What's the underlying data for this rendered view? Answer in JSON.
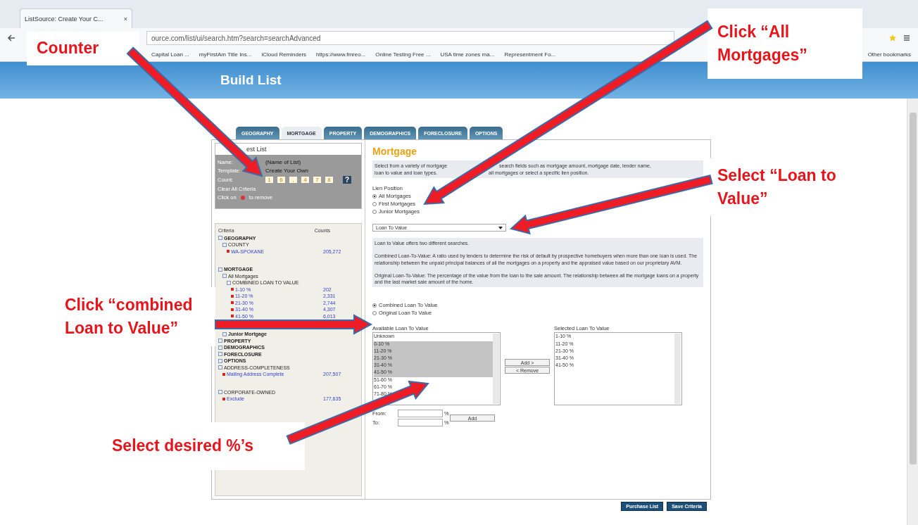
{
  "browser": {
    "tab_title": "ListSource: Create Your C...",
    "tab_close": "×",
    "address": "ource.com/list/ui/search.htm?search=searchAdvanced",
    "bookmarks": [
      "Capital Loan ...",
      "myFirstAm Title Ins...",
      "iCloud Reminders",
      "https://www.fmreo...",
      "Online Testing Free ...",
      "USA time zones ma...",
      "Representment Fo..."
    ],
    "other_bookmarks": "Other bookmarks"
  },
  "header": {
    "title": "Build List"
  },
  "tabs": [
    {
      "label": "GEOGRAPHY",
      "selected": false
    },
    {
      "label": "MORTGAGE",
      "selected": true
    },
    {
      "label": "PROPERTY",
      "selected": false
    },
    {
      "label": "DEMOGRAPHICS",
      "selected": false
    },
    {
      "label": "FORECLOSURE",
      "selected": false
    },
    {
      "label": "OPTIONS",
      "selected": false
    }
  ],
  "request": {
    "title": "est List",
    "name_label": "Name:",
    "name": "(Name of List)",
    "template_label": "Template:",
    "template": "Create Your Own",
    "count_label": "Count:",
    "count_digits": [
      "1",
      "6",
      ",",
      "4",
      "7",
      "8"
    ],
    "help": "?",
    "clear": "Clear All Criteria",
    "remove_hint": "Click on",
    "remove_hint_end": "to remove"
  },
  "criteria": {
    "heading": "Criteria",
    "counts_heading": "Counts",
    "items": [
      {
        "kind": "section",
        "label": "GEOGRAPHY",
        "children": [
          {
            "kind": "group",
            "label": "COUNTY",
            "children": [
              {
                "kind": "value",
                "label": "WA-SPOKANE",
                "count": "205,272"
              }
            ]
          }
        ]
      },
      {
        "kind": "section",
        "label": "MORTGAGE",
        "children": [
          {
            "kind": "group",
            "label": "All Mortgages",
            "children": [
              {
                "kind": "group",
                "label": "COMBINED LOAN TO VALUE",
                "children": [
                  {
                    "kind": "value",
                    "label": "1-10 %",
                    "count": "202"
                  },
                  {
                    "kind": "value",
                    "label": "11-20 %",
                    "count": "2,331"
                  },
                  {
                    "kind": "value",
                    "label": "21-30 %",
                    "count": "2,744"
                  },
                  {
                    "kind": "value",
                    "label": "31-40 %",
                    "count": "4,307"
                  },
                  {
                    "kind": "value",
                    "label": "41-50 %",
                    "count": "6,013"
                  }
                ]
              }
            ]
          },
          {
            "kind": "section",
            "label": "Junior Mortgage"
          }
        ]
      },
      {
        "kind": "section",
        "label": "PROPERTY"
      },
      {
        "kind": "section",
        "label": "DEMOGRAPHICS"
      },
      {
        "kind": "section",
        "label": "FORECLOSURE"
      },
      {
        "kind": "section",
        "label": "OPTIONS"
      },
      {
        "kind": "group",
        "label": "ADDRESS-COMPLETENESS",
        "children": [
          {
            "kind": "value",
            "label": "Mailing Address Complete",
            "count": "207,507"
          }
        ]
      },
      {
        "kind": "group",
        "label": "CORPORATE-OWNED",
        "children": [
          {
            "kind": "value",
            "label": "Exclude",
            "count": "177,635"
          }
        ]
      }
    ]
  },
  "mortgage": {
    "title": "Mortgage",
    "intro_lines": [
      {
        "before": "Select from a variety of mortgage",
        "after": "search fields such as mortgage amount, mortgage date, lender name,"
      },
      {
        "before": "loan to value and loan types.",
        "after": "all mortgages or select a specific lien position."
      }
    ],
    "lien_label": "Lien Position",
    "lien_options": [
      {
        "label": "All Mortgages",
        "selected": true
      },
      {
        "label": "First Mortgages",
        "selected": false
      },
      {
        "label": "Junior Mortgages",
        "selected": false
      }
    ],
    "field_select": "Loan To Value",
    "info": [
      "Loan to Value offers two different searches.",
      "Combined Loan-To-Value: A ratio used by lenders to determine the risk of default by prospective homebuyers when more than one loan is used. The relationship between the unpaid principal balances of all the mortgages on a property and the appraised value based on our proprietary AVM.",
      "Original Loan-To-Value: The percentage of the value from the loan to the sale amount. The relationship between all the mortgage loans on a property and the last market sale amount of the home."
    ],
    "ltv_types": [
      {
        "label": "Combined Loan To Value",
        "selected": true
      },
      {
        "label": "Original Loan To Value",
        "selected": false
      }
    ],
    "available_label": "Available Loan To Value",
    "available": [
      {
        "label": "Unknown",
        "selected": false
      },
      {
        "label": "0-10 %",
        "selected": true
      },
      {
        "label": "11-20 %",
        "selected": true
      },
      {
        "label": "21-30 %",
        "selected": true
      },
      {
        "label": "31-40 %",
        "selected": true
      },
      {
        "label": "41-50 %",
        "selected": true
      },
      {
        "label": "51-60 %",
        "selected": false
      },
      {
        "label": "61-70 %",
        "selected": false
      },
      {
        "label": "71-80 %",
        "selected": false
      }
    ],
    "add_button": "Add >",
    "remove_button": "< Remove",
    "selected_label": "Selected Loan To Value",
    "selected_items": [
      "1-10 %",
      "11-20 %",
      "21-30 %",
      "31-40 %",
      "41-50 %"
    ],
    "from_label": "From:",
    "to_label": "To:",
    "percent": "%",
    "range_add": "Add"
  },
  "footer_buttons": [
    "Purchase List",
    "Save Criteria"
  ],
  "callouts": [
    "Counter",
    "Click “All Mortgages”",
    "Select “Loan to Value”",
    "Click “combined Loan to Value”",
    "Select desired %’s"
  ]
}
